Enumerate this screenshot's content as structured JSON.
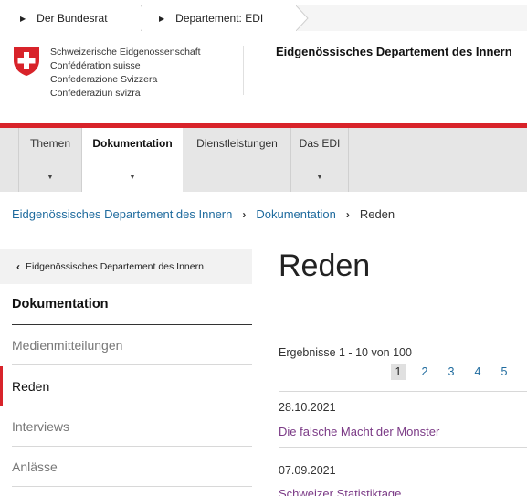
{
  "top_tabs": [
    {
      "label": "Der Bundesrat"
    },
    {
      "label": "Departement: EDI"
    }
  ],
  "logo": {
    "lines": [
      "Schweizerische Eidgenossenschaft",
      "Confédération suisse",
      "Confederazione Svizzera",
      "Confederaziun svizra"
    ],
    "flag_color": "#d8232a"
  },
  "header": {
    "title": "Eidgenössisches Departement des Innern"
  },
  "nav": {
    "items": [
      {
        "label": "Themen",
        "active": false
      },
      {
        "label": "Dokumentation",
        "active": true
      },
      {
        "label": "Dienstleistungen",
        "active": false
      },
      {
        "label": "Das EDI",
        "active": false
      }
    ]
  },
  "breadcrumb": {
    "items": [
      "Eidgenössisches Departement des Innern",
      "Dokumentation"
    ],
    "current": "Reden"
  },
  "sidebar": {
    "back_label": "Eidgenössisches Departement des Innern",
    "heading": "Dokumentation",
    "items": [
      {
        "label": "Medienmitteilungen",
        "active": false
      },
      {
        "label": "Reden",
        "active": true
      },
      {
        "label": "Interviews",
        "active": false
      },
      {
        "label": "Anlässe",
        "active": false
      }
    ]
  },
  "main": {
    "title": "Reden",
    "results_text": "Ergebnisse 1 - 10 von 100",
    "pages": [
      "1",
      "2",
      "3",
      "4",
      "5"
    ],
    "current_page": "1",
    "articles": [
      {
        "date": "28.10.2021",
        "title": "Die falsche Macht der Monster"
      },
      {
        "date": "07.09.2021",
        "title": "Schweizer Statistiktage"
      }
    ]
  },
  "colors": {
    "accent_red": "#d8232a",
    "link_blue": "#1f6b9e",
    "article_purple": "#7b3a86"
  }
}
